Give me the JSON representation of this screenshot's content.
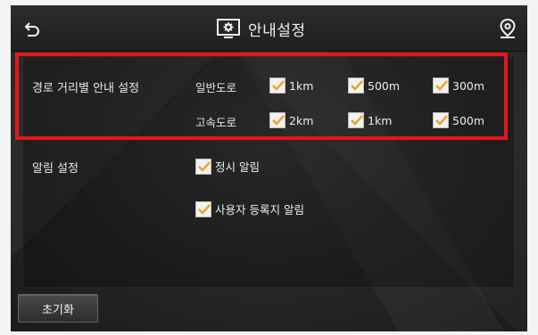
{
  "header": {
    "title": "안내설정",
    "back_icon": "back-arrow-icon",
    "title_icon": "settings-gear-icon",
    "nav_icon": "map-pin-icon"
  },
  "distance_section": {
    "label": "경로 거리별 안내 설정",
    "general_road": {
      "label": "일반도로",
      "options": [
        {
          "label": "1km",
          "checked": true
        },
        {
          "label": "500m",
          "checked": true
        },
        {
          "label": "300m",
          "checked": true
        }
      ]
    },
    "highway": {
      "label": "고속도로",
      "options": [
        {
          "label": "2km",
          "checked": true
        },
        {
          "label": "1km",
          "checked": true
        },
        {
          "label": "500m",
          "checked": true
        }
      ]
    }
  },
  "alert_section": {
    "label": "알림 설정",
    "options": [
      {
        "label": "정시 알림",
        "checked": true
      },
      {
        "label": "사용자 등록지 알림",
        "checked": true
      }
    ]
  },
  "reset_button": {
    "label": "초기화"
  },
  "colors": {
    "highlight": "#e4161e",
    "checkmark": "#f0a020",
    "background": "#262626"
  }
}
